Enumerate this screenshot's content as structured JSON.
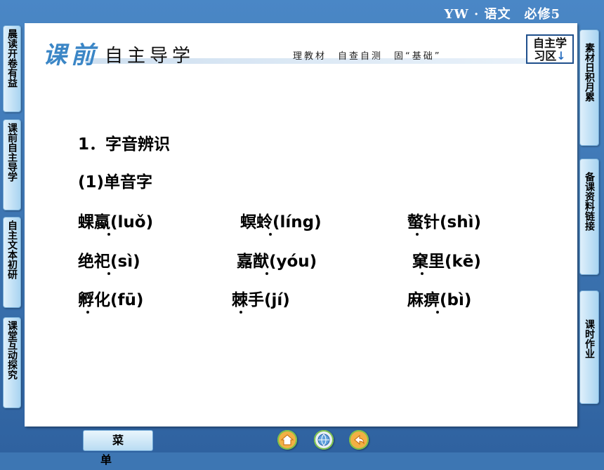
{
  "header": {
    "course_label": "YW · 语文　必修5",
    "brush_char_1": "课",
    "brush_char_2": "前",
    "section_title": "自主导学",
    "section_subtitle": "理教材　自查自测　固“基础”",
    "zone_badge_line1": "自主学",
    "zone_badge_line2": "习区",
    "zone_badge_arrow": "↓"
  },
  "left_nav": [
    {
      "label": "晨读开卷有益"
    },
    {
      "label": "课前自主导学"
    },
    {
      "label": "自主文本初研"
    },
    {
      "label": "课堂互动探究"
    }
  ],
  "right_nav": [
    {
      "label": "素材日积月累"
    },
    {
      "label": "备课资料链接"
    },
    {
      "label": "课时作业"
    }
  ],
  "content": {
    "heading": "1．字音辨识",
    "subheading": "(1)单音字",
    "items": [
      {
        "text": "蜾蠃(luǒ)"
      },
      {
        "text": "螟蛉(líng)"
      },
      {
        "text": "螫针(shì)"
      },
      {
        "text": "绝祀(sì)"
      },
      {
        "text": "嘉猷(yóu)"
      },
      {
        "text": "窠里(kē)"
      },
      {
        "text": "孵化(fū)"
      },
      {
        "text": "棘手(jí)"
      },
      {
        "text": "麻痹(bì)"
      }
    ]
  },
  "footer": {
    "menu_label": "菜单"
  },
  "colors": {
    "background": "#3d76b3",
    "accent": "#3b86c6",
    "nav_button": "#bfe0f5",
    "nav_circle_ring": "#7bc24a"
  },
  "icons": [
    "home-icon",
    "globe-icon",
    "back-icon",
    "down-arrow-icon"
  ]
}
